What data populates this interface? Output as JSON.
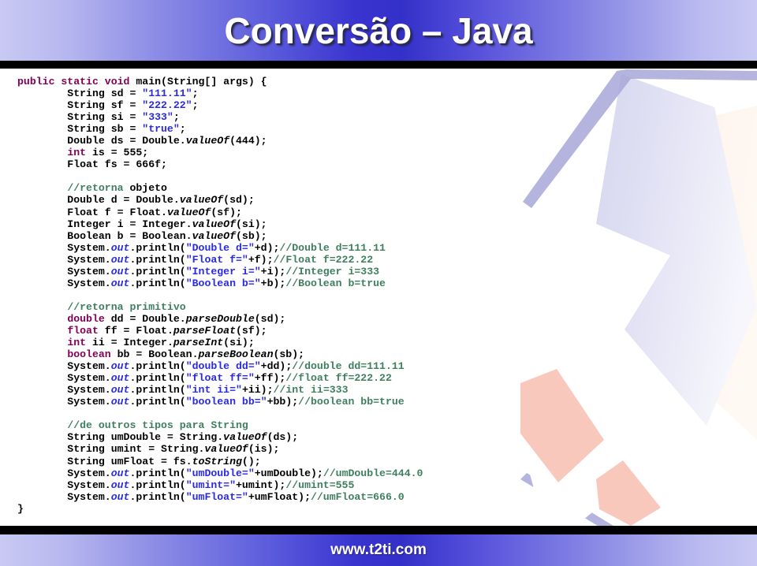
{
  "slide": {
    "title": "Conversão – Java",
    "footer": "www.t2ti.com"
  },
  "theme": {
    "header_gradient_edge": "#c9c9f4",
    "header_gradient_center": "#3330c9",
    "rule_color": "#000000",
    "title_color": "#ffffff",
    "footer_color": "#ffffff",
    "code_keyword_color": "#7f0055",
    "code_string_color": "#2a2ae0",
    "code_comment_color": "#3f7f5f",
    "code_plain_color": "#000000",
    "deco_lavender": "#dcdcf2",
    "deco_periwinkle": "#a7a7d8",
    "deco_salmon": "#f8c8bc"
  },
  "code": {
    "language": "Java",
    "lines": [
      [
        {
          "t": "public static void ",
          "c": "kw"
        },
        {
          "t": "main",
          "c": "pl"
        },
        {
          "t": "(String[] args) {",
          "c": "pl"
        }
      ],
      [
        {
          "t": "        String sd = ",
          "c": "pl"
        },
        {
          "t": "\"111.11\"",
          "c": "str"
        },
        {
          "t": ";",
          "c": "pl"
        }
      ],
      [
        {
          "t": "        String sf = ",
          "c": "pl"
        },
        {
          "t": "\"222.22\"",
          "c": "str"
        },
        {
          "t": ";",
          "c": "pl"
        }
      ],
      [
        {
          "t": "        String si = ",
          "c": "pl"
        },
        {
          "t": "\"333\"",
          "c": "str"
        },
        {
          "t": ";",
          "c": "pl"
        }
      ],
      [
        {
          "t": "        String sb = ",
          "c": "pl"
        },
        {
          "t": "\"true\"",
          "c": "str"
        },
        {
          "t": ";",
          "c": "pl"
        }
      ],
      [
        {
          "t": "        Double ds = Double.",
          "c": "pl"
        },
        {
          "t": "valueOf",
          "c": "mth"
        },
        {
          "t": "(444);",
          "c": "pl"
        }
      ],
      [
        {
          "t": "        ",
          "c": "pl"
        },
        {
          "t": "int",
          "c": "kw"
        },
        {
          "t": " is = 555;",
          "c": "pl"
        }
      ],
      [
        {
          "t": "        Float fs = 666f;",
          "c": "pl"
        }
      ],
      [
        {
          "t": "",
          "c": "pl"
        }
      ],
      [
        {
          "t": "        ",
          "c": "pl"
        },
        {
          "t": "//retorna",
          "c": "cm"
        },
        {
          "t": " objeto",
          "c": "pl"
        }
      ],
      [
        {
          "t": "        Double d = Double.",
          "c": "pl"
        },
        {
          "t": "valueOf",
          "c": "mth"
        },
        {
          "t": "(sd);",
          "c": "pl"
        }
      ],
      [
        {
          "t": "        Float f = Float.",
          "c": "pl"
        },
        {
          "t": "valueOf",
          "c": "mth"
        },
        {
          "t": "(sf);",
          "c": "pl"
        }
      ],
      [
        {
          "t": "        Integer i = Integer.",
          "c": "pl"
        },
        {
          "t": "valueOf",
          "c": "mth"
        },
        {
          "t": "(si);",
          "c": "pl"
        }
      ],
      [
        {
          "t": "        Boolean b = Boolean.",
          "c": "pl"
        },
        {
          "t": "valueOf",
          "c": "mth"
        },
        {
          "t": "(sb);",
          "c": "pl"
        }
      ],
      [
        {
          "t": "        System.",
          "c": "pl"
        },
        {
          "t": "out",
          "c": "fld"
        },
        {
          "t": ".println(",
          "c": "pl"
        },
        {
          "t": "\"Double d=\"",
          "c": "str"
        },
        {
          "t": "+d);",
          "c": "pl"
        },
        {
          "t": "//Double d=111.11",
          "c": "cm"
        }
      ],
      [
        {
          "t": "        System.",
          "c": "pl"
        },
        {
          "t": "out",
          "c": "fld"
        },
        {
          "t": ".println(",
          "c": "pl"
        },
        {
          "t": "\"Float f=\"",
          "c": "str"
        },
        {
          "t": "+f);",
          "c": "pl"
        },
        {
          "t": "//Float f=222.22",
          "c": "cm"
        }
      ],
      [
        {
          "t": "        System.",
          "c": "pl"
        },
        {
          "t": "out",
          "c": "fld"
        },
        {
          "t": ".println(",
          "c": "pl"
        },
        {
          "t": "\"Integer i=\"",
          "c": "str"
        },
        {
          "t": "+i);",
          "c": "pl"
        },
        {
          "t": "//Integer i=333",
          "c": "cm"
        }
      ],
      [
        {
          "t": "        System.",
          "c": "pl"
        },
        {
          "t": "out",
          "c": "fld"
        },
        {
          "t": ".println(",
          "c": "pl"
        },
        {
          "t": "\"Boolean b=\"",
          "c": "str"
        },
        {
          "t": "+b);",
          "c": "pl"
        },
        {
          "t": "//Boolean b=true",
          "c": "cm"
        }
      ],
      [
        {
          "t": "",
          "c": "pl"
        }
      ],
      [
        {
          "t": "        ",
          "c": "pl"
        },
        {
          "t": "//retorna primitivo",
          "c": "cm"
        }
      ],
      [
        {
          "t": "        ",
          "c": "pl"
        },
        {
          "t": "double",
          "c": "kw"
        },
        {
          "t": " dd = Double.",
          "c": "pl"
        },
        {
          "t": "parseDouble",
          "c": "mth"
        },
        {
          "t": "(sd);",
          "c": "pl"
        }
      ],
      [
        {
          "t": "        ",
          "c": "pl"
        },
        {
          "t": "float",
          "c": "kw"
        },
        {
          "t": " ff = Float.",
          "c": "pl"
        },
        {
          "t": "parseFloat",
          "c": "mth"
        },
        {
          "t": "(sf);",
          "c": "pl"
        }
      ],
      [
        {
          "t": "        ",
          "c": "pl"
        },
        {
          "t": "int",
          "c": "kw"
        },
        {
          "t": " ii = Integer.",
          "c": "pl"
        },
        {
          "t": "parseInt",
          "c": "mth"
        },
        {
          "t": "(si);",
          "c": "pl"
        }
      ],
      [
        {
          "t": "        ",
          "c": "pl"
        },
        {
          "t": "boolean",
          "c": "kw"
        },
        {
          "t": " bb = Boolean.",
          "c": "pl"
        },
        {
          "t": "parseBoolean",
          "c": "mth"
        },
        {
          "t": "(sb);",
          "c": "pl"
        }
      ],
      [
        {
          "t": "        System.",
          "c": "pl"
        },
        {
          "t": "out",
          "c": "fld"
        },
        {
          "t": ".println(",
          "c": "pl"
        },
        {
          "t": "\"double dd=\"",
          "c": "str"
        },
        {
          "t": "+dd);",
          "c": "pl"
        },
        {
          "t": "//double dd=111.11",
          "c": "cm"
        }
      ],
      [
        {
          "t": "        System.",
          "c": "pl"
        },
        {
          "t": "out",
          "c": "fld"
        },
        {
          "t": ".println(",
          "c": "pl"
        },
        {
          "t": "\"float ff=\"",
          "c": "str"
        },
        {
          "t": "+ff);",
          "c": "pl"
        },
        {
          "t": "//float ff=222.22",
          "c": "cm"
        }
      ],
      [
        {
          "t": "        System.",
          "c": "pl"
        },
        {
          "t": "out",
          "c": "fld"
        },
        {
          "t": ".println(",
          "c": "pl"
        },
        {
          "t": "\"int ii=\"",
          "c": "str"
        },
        {
          "t": "+ii);",
          "c": "pl"
        },
        {
          "t": "//int ii=333",
          "c": "cm"
        }
      ],
      [
        {
          "t": "        System.",
          "c": "pl"
        },
        {
          "t": "out",
          "c": "fld"
        },
        {
          "t": ".println(",
          "c": "pl"
        },
        {
          "t": "\"boolean bb=\"",
          "c": "str"
        },
        {
          "t": "+bb);",
          "c": "pl"
        },
        {
          "t": "//boolean bb=true",
          "c": "cm"
        }
      ],
      [
        {
          "t": "",
          "c": "pl"
        }
      ],
      [
        {
          "t": "        ",
          "c": "pl"
        },
        {
          "t": "//de outros tipos para String",
          "c": "cm"
        }
      ],
      [
        {
          "t": "        String umDouble = String.",
          "c": "pl"
        },
        {
          "t": "valueOf",
          "c": "mth"
        },
        {
          "t": "(ds);",
          "c": "pl"
        }
      ],
      [
        {
          "t": "        String umint = String.",
          "c": "pl"
        },
        {
          "t": "valueOf",
          "c": "mth"
        },
        {
          "t": "(is);",
          "c": "pl"
        }
      ],
      [
        {
          "t": "        String umFloat = fs.",
          "c": "pl"
        },
        {
          "t": "toString",
          "c": "mth"
        },
        {
          "t": "();",
          "c": "pl"
        }
      ],
      [
        {
          "t": "        System.",
          "c": "pl"
        },
        {
          "t": "out",
          "c": "fld"
        },
        {
          "t": ".println(",
          "c": "pl"
        },
        {
          "t": "\"umDouble=\"",
          "c": "str"
        },
        {
          "t": "+umDouble);",
          "c": "pl"
        },
        {
          "t": "//umDouble=444.0",
          "c": "cm"
        }
      ],
      [
        {
          "t": "        System.",
          "c": "pl"
        },
        {
          "t": "out",
          "c": "fld"
        },
        {
          "t": ".println(",
          "c": "pl"
        },
        {
          "t": "\"umint=\"",
          "c": "str"
        },
        {
          "t": "+umint);",
          "c": "pl"
        },
        {
          "t": "//umint=555",
          "c": "cm"
        }
      ],
      [
        {
          "t": "        System.",
          "c": "pl"
        },
        {
          "t": "out",
          "c": "fld"
        },
        {
          "t": ".println(",
          "c": "pl"
        },
        {
          "t": "\"umFloat=\"",
          "c": "str"
        },
        {
          "t": "+umFloat);",
          "c": "pl"
        },
        {
          "t": "//umFloat=666.0",
          "c": "cm"
        }
      ],
      [
        {
          "t": "}",
          "c": "pl"
        }
      ]
    ]
  }
}
